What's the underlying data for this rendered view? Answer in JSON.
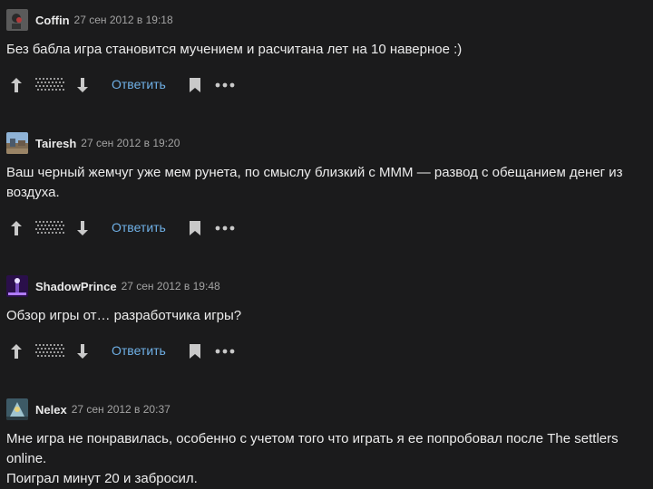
{
  "comments": [
    {
      "user": "Coffin",
      "time": "27 сен 2012 в 19:18",
      "text": "Без бабла игра становится мучением и расчитана лет на 10 наверное :)",
      "reply_label": "Ответить"
    },
    {
      "user": "Tairesh",
      "time": "27 сен 2012 в 19:20",
      "text": "Ваш черный жемчуг уже мем рунета, по смыслу близкий с МММ — развод с обещанием денег из\nвоздуха.",
      "reply_label": "Ответить"
    },
    {
      "user": "ShadowPrince",
      "time": "27 сен 2012 в 19:48",
      "text": "Обзор игры от… разработчика игры?",
      "reply_label": "Ответить"
    },
    {
      "user": "Nelex",
      "time": "27 сен 2012 в 20:37",
      "text": "Мне игра не понравилась, особенно с учетом того что играть я ее попробовал после The settlers online.\nПоиграл минут 20 и забросил."
    }
  ],
  "icons": {
    "upvote": "arrow-up-icon",
    "downvote": "arrow-down-icon",
    "bookmark": "bookmark-icon",
    "more": "more-dots-icon"
  },
  "colors": {
    "background": "#1b1b1c",
    "link": "#6fb0e6",
    "icon": "#c9c9c9"
  }
}
